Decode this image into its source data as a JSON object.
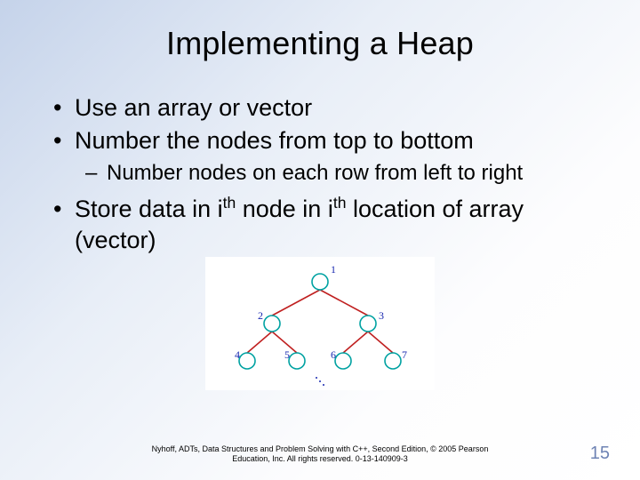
{
  "title": "Implementing a Heap",
  "bullets": {
    "b1": "Use an array or vector",
    "b2": "Number the nodes from top to bottom",
    "b2_sub1": "Number nodes on each row from left to right",
    "b3_pre": "Store data in i",
    "b3_sup1": "th",
    "b3_mid": " node in i",
    "b3_sup2": "th",
    "b3_post": " location of array (vector)"
  },
  "tree": {
    "labels": {
      "n1": "1",
      "n2": "2",
      "n3": "3",
      "n4": "4",
      "n5": "5",
      "n6": "6",
      "n7": "7"
    }
  },
  "footer": {
    "line1": "Nyhoff, ADTs, Data Structures and Problem Solving with C++, Second Edition, © 2005 Pearson",
    "line2": "Education, Inc. All rights reserved. 0-13-140909-3"
  },
  "page_number": "15"
}
